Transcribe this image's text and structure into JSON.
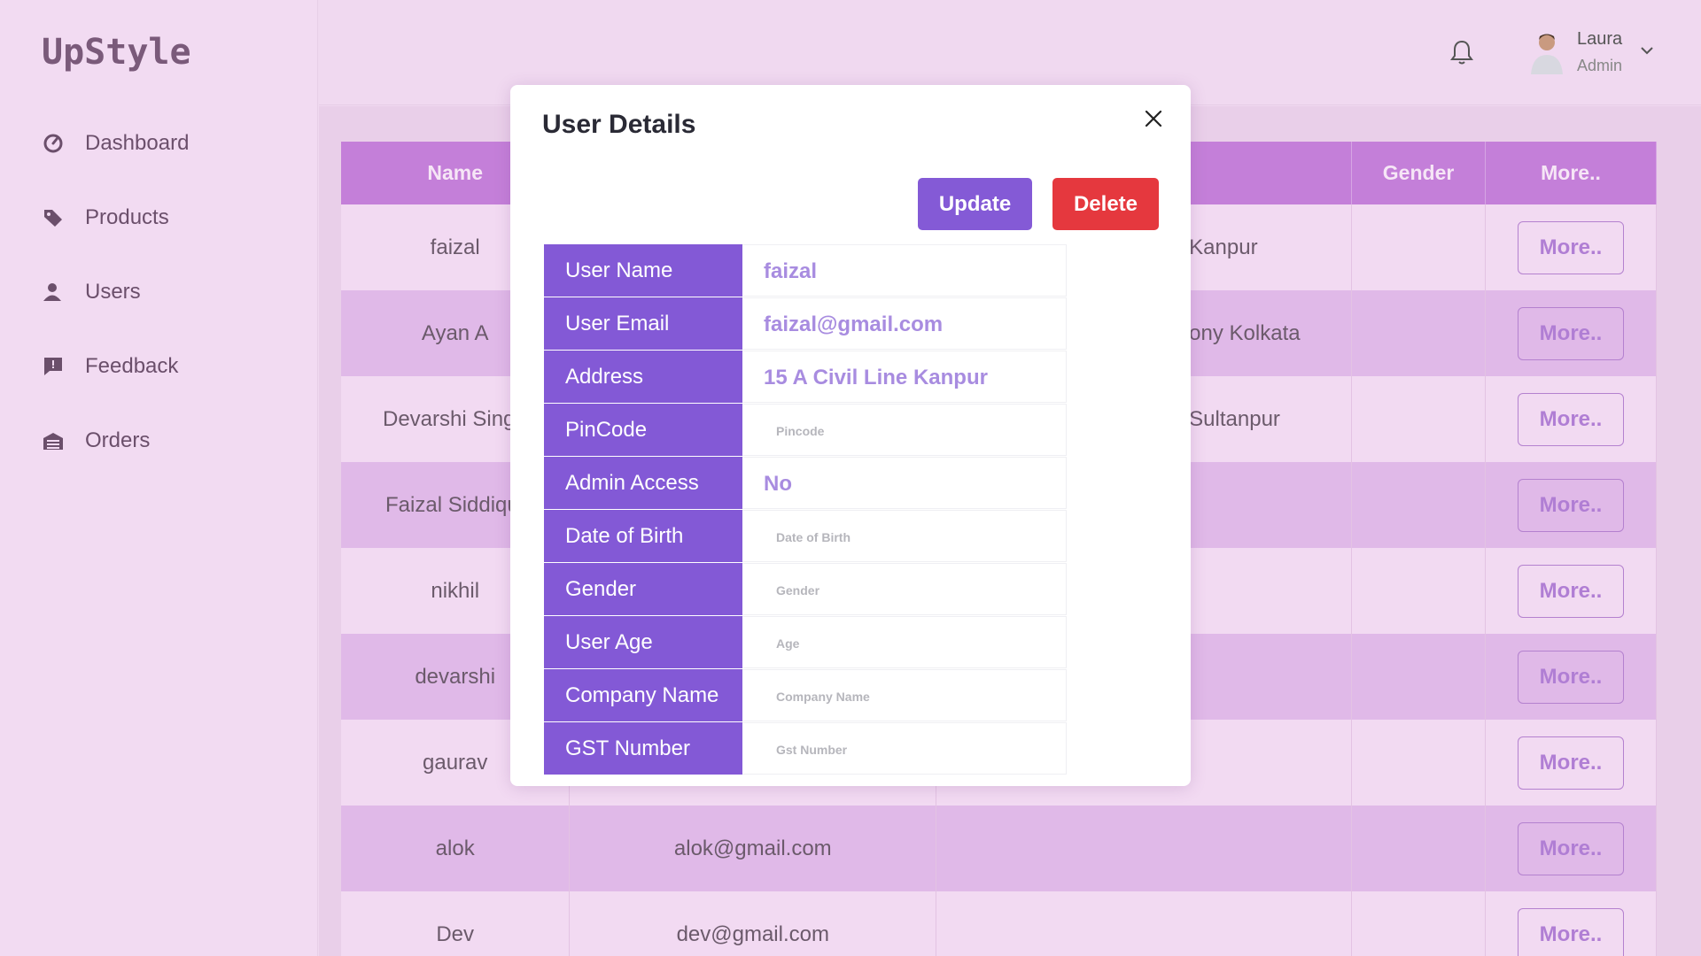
{
  "app": {
    "logo": "UpStyle"
  },
  "sidebar": {
    "items": [
      {
        "label": "Dashboard",
        "icon": "dashboard-icon"
      },
      {
        "label": "Products",
        "icon": "tag-icon"
      },
      {
        "label": "Users",
        "icon": "user-icon"
      },
      {
        "label": "Feedback",
        "icon": "feedback-icon"
      },
      {
        "label": "Orders",
        "icon": "orders-icon"
      }
    ]
  },
  "header": {
    "user": {
      "name": "Laura",
      "role": "Admin"
    }
  },
  "table": {
    "headers": [
      "Name",
      "",
      "",
      "Gender",
      "More.."
    ],
    "rows": [
      {
        "name": "faizal",
        "email": "",
        "address": "Kanpur",
        "gender": "",
        "more": "More.."
      },
      {
        "name": "Ayan A",
        "email": "",
        "address": "ony Kolkata",
        "gender": "",
        "more": "More.."
      },
      {
        "name": "Devarshi Sing",
        "email": "",
        "address": "Sultanpur",
        "gender": "",
        "more": "More.."
      },
      {
        "name": "Faizal Siddiqu",
        "email": "",
        "address": "",
        "gender": "",
        "more": "More.."
      },
      {
        "name": "nikhil",
        "email": "",
        "address": "",
        "gender": "",
        "more": "More.."
      },
      {
        "name": "devarshi",
        "email": "",
        "address": "",
        "gender": "",
        "more": "More.."
      },
      {
        "name": "gaurav",
        "email": "",
        "address": "",
        "gender": "",
        "more": "More.."
      },
      {
        "name": "alok",
        "email": "alok@gmail.com",
        "address": "",
        "gender": "",
        "more": "More.."
      },
      {
        "name": "Dev",
        "email": "dev@gmail.com",
        "address": "",
        "gender": "",
        "more": "More.."
      }
    ]
  },
  "modal": {
    "title": "User Details",
    "update_label": "Update",
    "delete_label": "Delete",
    "fields": [
      {
        "label": "User Name",
        "value": "faizal",
        "placeholder": ""
      },
      {
        "label": "User Email",
        "value": "faizal@gmail.com",
        "placeholder": ""
      },
      {
        "label": "Address",
        "value": "15 A Civil Line Kanpur",
        "placeholder": ""
      },
      {
        "label": "PinCode",
        "value": "",
        "placeholder": "Pincode"
      },
      {
        "label": "Admin Access",
        "value": "No",
        "placeholder": ""
      },
      {
        "label": "Date of Birth",
        "value": "",
        "placeholder": "Date of Birth"
      },
      {
        "label": "Gender",
        "value": "",
        "placeholder": "Gender"
      },
      {
        "label": "User Age",
        "value": "",
        "placeholder": "Age"
      },
      {
        "label": "Company Name",
        "value": "",
        "placeholder": "Company Name"
      },
      {
        "label": "GST Number",
        "value": "",
        "placeholder": "Gst Number"
      }
    ]
  },
  "colors": {
    "accent": "#8359d6",
    "danger": "#e5383e",
    "table_header": "#c47fd9",
    "background": "#f0d9f0"
  }
}
